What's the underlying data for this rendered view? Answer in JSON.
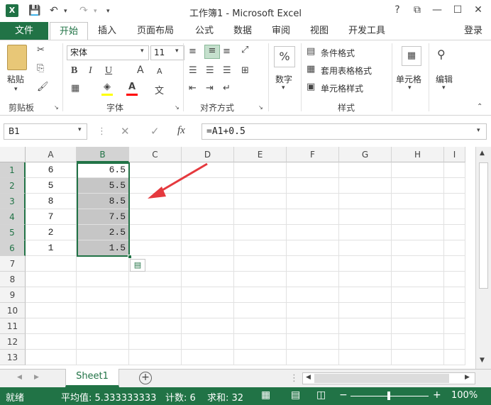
{
  "window": {
    "title": "工作簿1 - Microsoft Excel",
    "help": "?",
    "restore": "⧉",
    "minimize": "—",
    "maximize": "☐",
    "close": "✕"
  },
  "tabs": {
    "file": "文件",
    "items": [
      "开始",
      "插入",
      "页面布局",
      "公式",
      "数据",
      "审阅",
      "视图",
      "开发工具"
    ],
    "login": "登录"
  },
  "ribbon": {
    "clipboard": {
      "paste": "粘贴",
      "label": "剪贴板"
    },
    "font": {
      "name": "宋体",
      "size": "11",
      "label": "字体",
      "bold": "B",
      "italic": "I",
      "underline": "U",
      "grow": "A",
      "shrink": "A"
    },
    "align": {
      "label": "对齐方式"
    },
    "number": {
      "btn": "数字"
    },
    "styles": {
      "cond": "条件格式",
      "table": "套用表格格式",
      "cell": "单元格样式",
      "label": "样式"
    },
    "cells": {
      "btn": "单元格"
    },
    "edit": {
      "btn": "编辑"
    }
  },
  "formula_bar": {
    "name_box": "B1",
    "cancel": "✕",
    "enter": "✓",
    "fx": "fx",
    "formula": "=A1+0.5"
  },
  "grid": {
    "columns": [
      "A",
      "B",
      "C",
      "D",
      "E",
      "F",
      "G",
      "H",
      "I"
    ],
    "rows": [
      "1",
      "2",
      "3",
      "4",
      "5",
      "6",
      "7",
      "8",
      "9",
      "10",
      "11",
      "12",
      "13"
    ],
    "colA": [
      "6",
      "5",
      "8",
      "7",
      "2",
      "1"
    ],
    "colB": [
      "6.5",
      "5.5",
      "8.5",
      "7.5",
      "2.5",
      "1.5"
    ]
  },
  "sheets": {
    "active": "Sheet1",
    "add": "+"
  },
  "status": {
    "ready": "就绪",
    "average": "平均值: 5.333333333",
    "count": "计数: 6",
    "sum": "求和: 32",
    "zoom": "100%"
  },
  "colors": {
    "accent": "#217346",
    "selection": "#c6c6c6",
    "arrow": "#e5393e"
  }
}
